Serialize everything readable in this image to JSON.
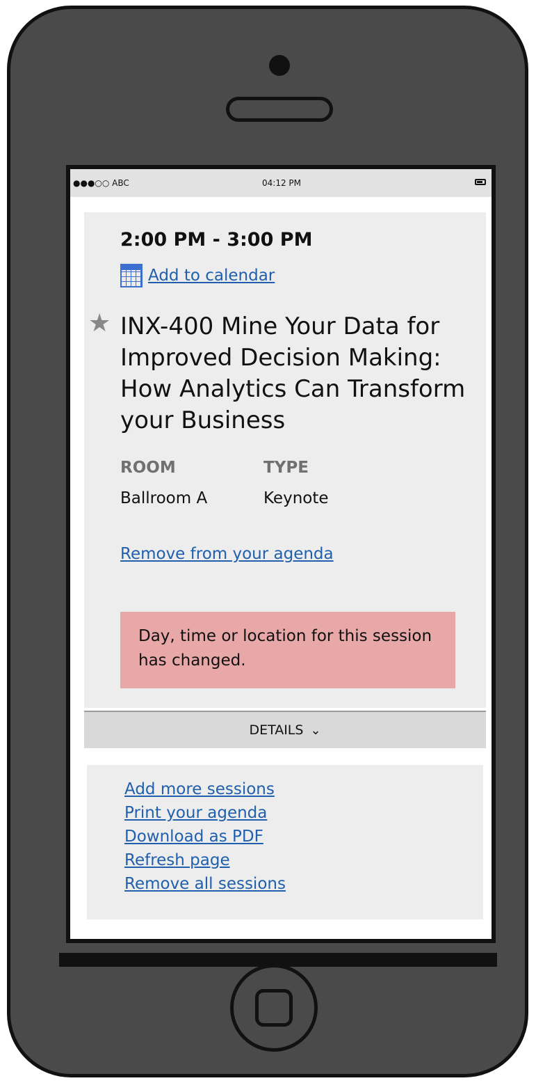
{
  "status_bar": {
    "carrier": "●●●○○ ABC",
    "time": "04:12 PM",
    "battery_icon": "battery-icon"
  },
  "session": {
    "time_range": "2:00 PM - 3:00 PM",
    "add_to_calendar": "Add to calendar",
    "calendar_icon": "calendar-icon",
    "star_icon": "star-icon",
    "title": "INX-400 Mine Your Data for Improved Decision Making: How Analytics Can Transform your Business",
    "room_label": "ROOM",
    "room_value": "Ballroom A",
    "type_label": "TYPE",
    "type_value": "Keynote",
    "remove_link": "Remove from your agenda",
    "alert_text": "Day, time or location for this session has changed.",
    "details_label": "DETAILS",
    "details_icon": "chevron-down-icon"
  },
  "actions": [
    "Add more sessions",
    "Print your agenda",
    "Download as PDF",
    "Refresh page",
    "Remove all sessions"
  ],
  "colors": {
    "link": "#1f5fae",
    "alert_bg": "#e8a8a8",
    "card_bg": "#ededed",
    "device_body": "#4a4a4a"
  }
}
